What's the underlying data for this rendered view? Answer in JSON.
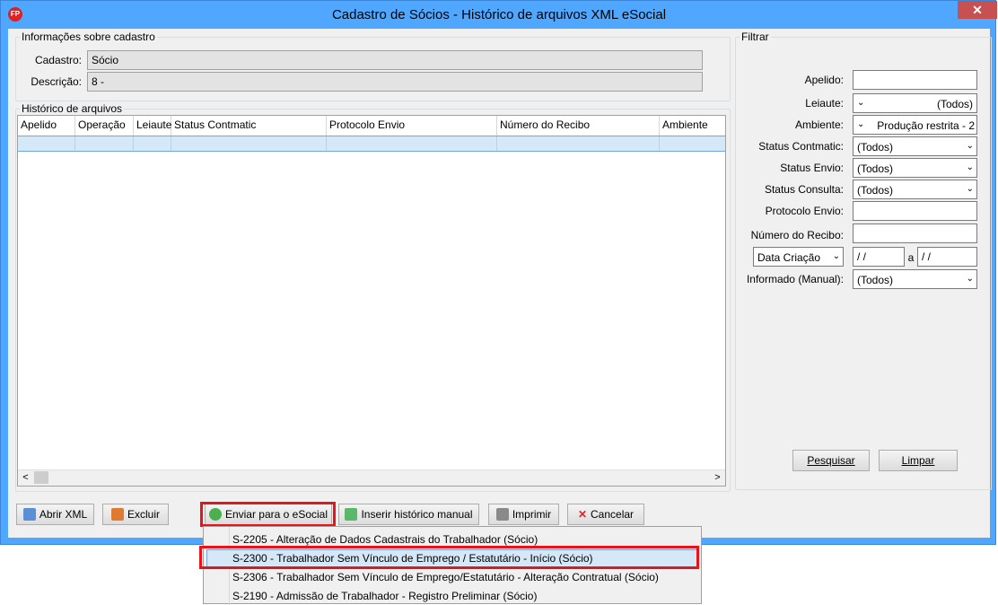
{
  "window": {
    "title": "Cadastro de Sócios - Histórico de arquivos XML eSocial",
    "close_glyph": "✕",
    "app_icon_text": "FP"
  },
  "info": {
    "legend": "Informações sobre cadastro",
    "cadastro_label": "Cadastro:",
    "cadastro_value": "Sócio",
    "descricao_label": "Descrição:",
    "descricao_value": "8 -"
  },
  "history": {
    "legend": "Histórico de arquivos",
    "columns": [
      "Apelido",
      "Operação",
      "Leiaute",
      "Status Contmatic",
      "Protocolo Envio",
      "Número do Recibo",
      "Ambiente"
    ],
    "scroll_left": "<",
    "scroll_right": ">"
  },
  "filter": {
    "legend": "Filtrar",
    "apelido_label": "Apelido:",
    "apelido_value": "",
    "leiaute_label": "Leiaute:",
    "leiaute_value": "(Todos)",
    "ambiente_label": "Ambiente:",
    "ambiente_value": "Produção restrita - 2",
    "status_contmatic_label": "Status Contmatic:",
    "status_contmatic_value": "(Todos)",
    "status_envio_label": "Status Envio:",
    "status_envio_value": "(Todos)",
    "status_consulta_label": "Status Consulta:",
    "status_consulta_value": "(Todos)",
    "protocolo_label": "Protocolo Envio:",
    "protocolo_value": "",
    "recibo_label": "Número do Recibo:",
    "recibo_value": "",
    "data_select": "Data Criação",
    "date_from": " / /",
    "date_sep": "a",
    "date_to": " / /",
    "informado_label": "Informado (Manual):",
    "informado_value": "(Todos)",
    "pesquisar": "Pesquisar",
    "limpar": "Limpar"
  },
  "buttons": {
    "abrir_xml": "Abrir XML",
    "excluir": "Excluir",
    "enviar": "Enviar para o eSocial",
    "inserir": "Inserir histórico manual",
    "imprimir": "Imprimir",
    "cancelar": "Cancelar"
  },
  "menu": {
    "items": [
      "S-2205 - Alteração de Dados Cadastrais do Trabalhador (Sócio)",
      "S-2300 - Trabalhador Sem Vínculo de Emprego / Estatutário - Início (Sócio)",
      "S-2306 - Trabalhador Sem Vínculo de Emprego/Estatutário - Alteração Contratual (Sócio)",
      "S-2190 - Admissão de Trabalhador - Registro Preliminar (Sócio)"
    ]
  },
  "colors": {
    "accent_highlight": "#e8141a",
    "title_bar": "#4fa7ff",
    "close_button": "#c75050",
    "selection": "#d5e8f7"
  }
}
